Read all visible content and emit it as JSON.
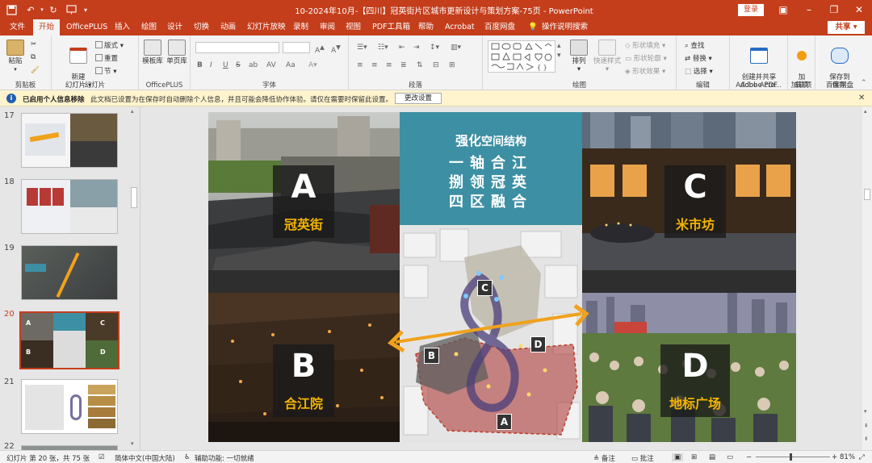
{
  "titlebar": {
    "title": "10-2024年10月-【四川】冠英街片区城市更新设计与策划方案-75页  -  PowerPoint",
    "login": "登录",
    "accent": "#c43e1c"
  },
  "tabs": [
    "文件",
    "开始",
    "OfficePLUS",
    "插入",
    "绘图",
    "设计",
    "切换",
    "动画",
    "幻灯片放映",
    "录制",
    "审阅",
    "视图",
    "PDF工具箱",
    "帮助",
    "Acrobat",
    "百度网盘",
    "操作说明搜索"
  ],
  "share": "共享",
  "ribbon": {
    "clipboard": {
      "paste": "粘贴",
      "label": "剪贴板"
    },
    "slides": {
      "new_slide": "新建\n幻灯片",
      "layout": "版式",
      "reset": "重置",
      "section": "节",
      "label": "幻灯片"
    },
    "officeplus": {
      "template": "模板库",
      "pages": "单页库",
      "label": "OfficePLUS"
    },
    "font": {
      "bold": "B",
      "italic": "I",
      "underline": "U",
      "strike": "S",
      "shadow": "ab",
      "spacing": "AV",
      "case": "Aa",
      "label": "字体"
    },
    "paragraph": {
      "label": "段落"
    },
    "drawing": {
      "arrange": "排列",
      "quick_styles": "快速样式",
      "fill": "形状填充",
      "outline": "形状轮廓",
      "effects": "形状效果",
      "label": "绘图"
    },
    "editing": {
      "find": "查找",
      "replace": "替换",
      "select": "选择",
      "label": "编辑"
    },
    "acrobat": {
      "create": "创建并共享\nAdobe PDF",
      "label": "Adobe Acro..."
    },
    "addins": {
      "addin": "加\n载项",
      "label": "加载项"
    },
    "save": {
      "save_baidu": "保存到\n百度网盘",
      "label": "保存"
    }
  },
  "infobar": {
    "title": "已启用个人信息移除",
    "message": "此文档已设置为在保存时自动删除个人信息，并且可能会降低协作体验。请仅在需要时保留此设置。",
    "button": "更改设置"
  },
  "thumbnails": [
    {
      "number": "17",
      "current": false
    },
    {
      "number": "18",
      "current": false
    },
    {
      "number": "19",
      "current": false
    },
    {
      "number": "20",
      "current": true
    },
    {
      "number": "21",
      "current": false
    },
    {
      "number": "22",
      "current": false
    }
  ],
  "slide": {
    "center_title_bold": "强化",
    "center_title_rest": "空间结构",
    "center_lines": [
      "一轴合江",
      "捌领冠英",
      "四区融合"
    ],
    "panels": [
      {
        "letter": "A",
        "name": "冠英街"
      },
      {
        "letter": "B",
        "name": "合江院"
      },
      {
        "letter": "C",
        "name": "米市坊"
      },
      {
        "letter": "D",
        "name": "地标广场"
      }
    ],
    "map_tags": [
      "C",
      "B",
      "D",
      "A"
    ],
    "colors": {
      "teal": "#3d8fa3",
      "yellow": "#f4b400",
      "orange": "#f0a21c",
      "red": "#b83a36"
    }
  },
  "status": {
    "slide_info": "幻灯片 第 20 张，共 75 张",
    "language": "简体中文(中国大陆)",
    "accessibility": "辅助功能: 一切就绪",
    "notes": "备注",
    "comments": "批注",
    "zoom": "81%"
  }
}
